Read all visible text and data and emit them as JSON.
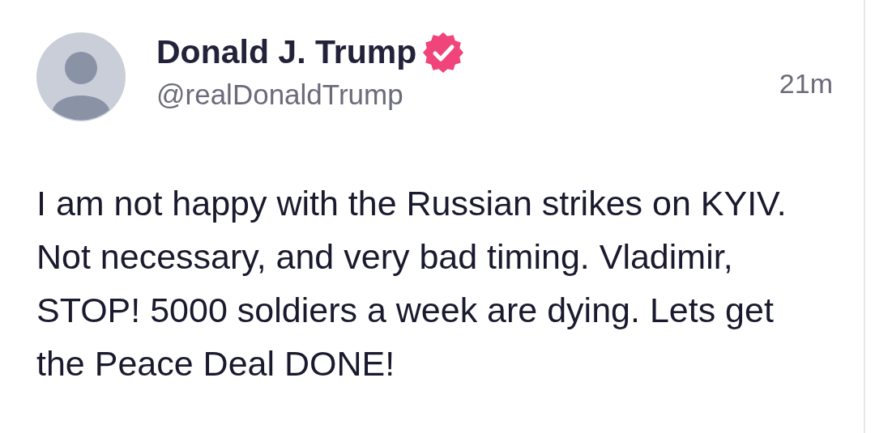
{
  "post": {
    "author": {
      "name": "Donald J. Trump",
      "verified": true,
      "handle": "@realDonaldTrump"
    },
    "time": "21m",
    "text": "I am not happy with the Russian strikes on KYIV. Not necessary, and very bad timing. Vladimir, STOP! 5000 soldiers a week are dying. Lets get the Peace Deal DONE!"
  }
}
